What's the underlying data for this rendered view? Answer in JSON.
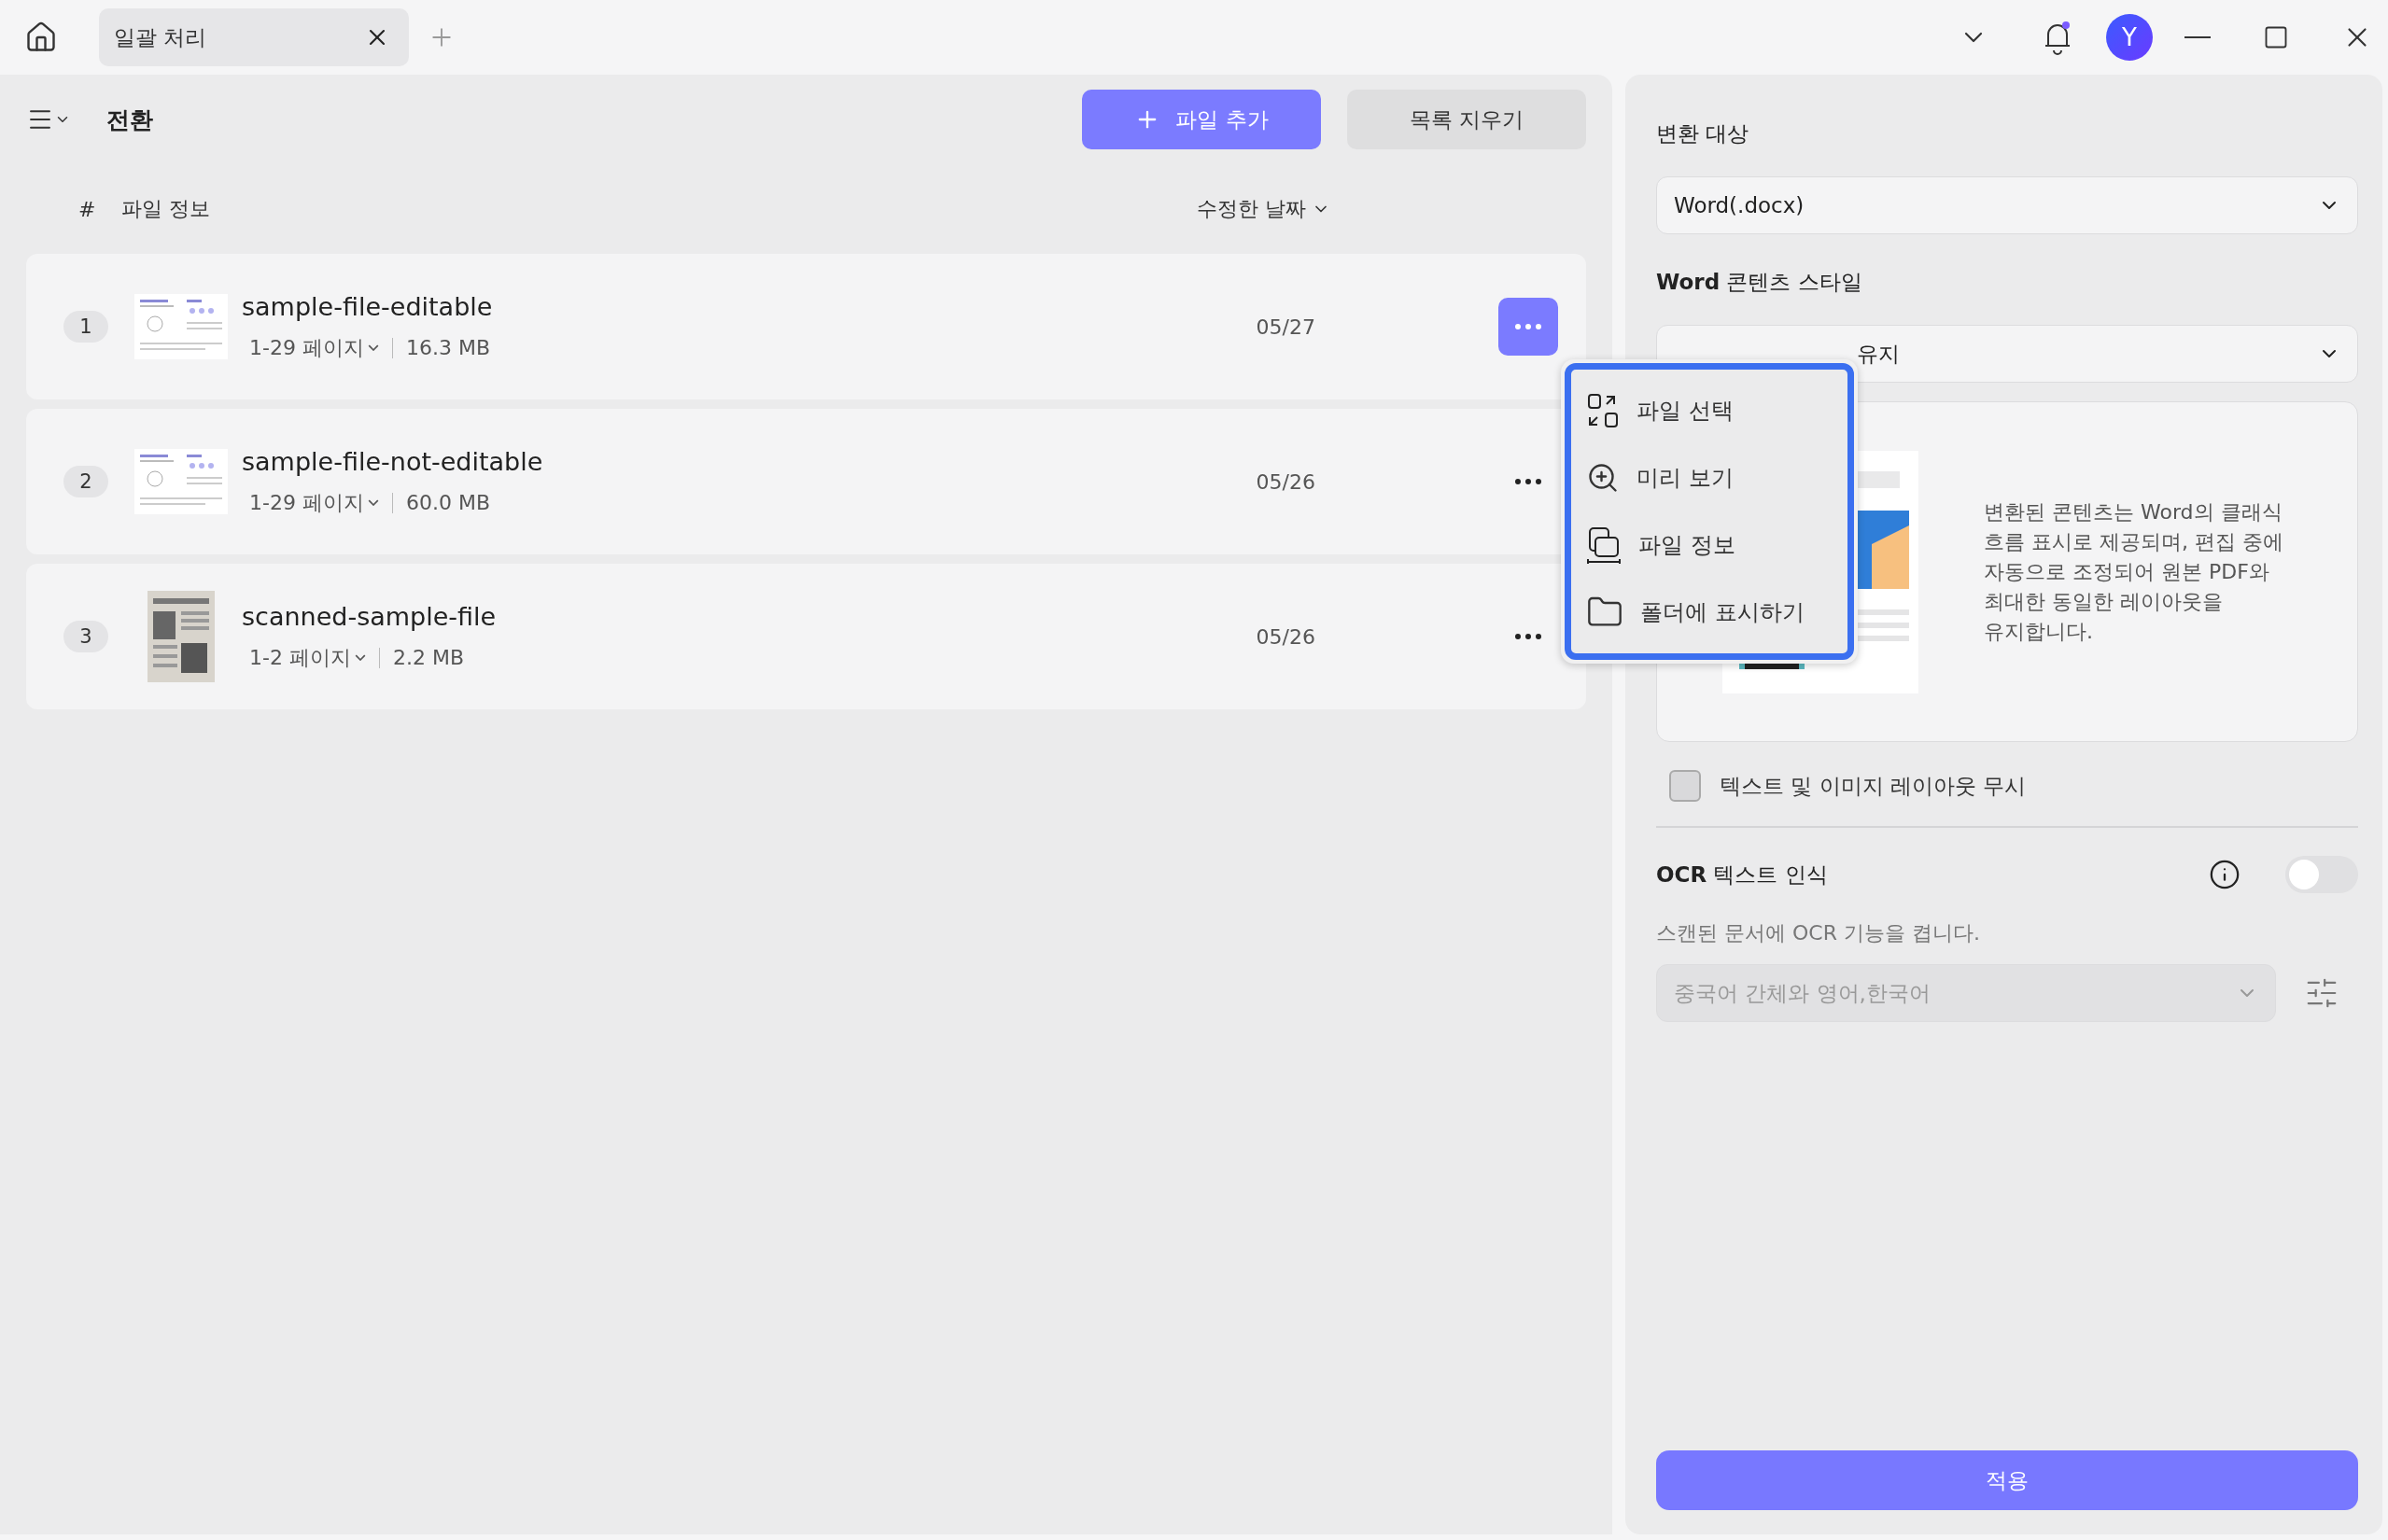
{
  "tab": {
    "title": "일괄 처리"
  },
  "avatar": "Y",
  "toolbar": {
    "title": "전환",
    "add_button": "파일 추가",
    "clear_button": "목록 지우기"
  },
  "columns": {
    "number": "#",
    "info": "파일 정보",
    "date": "수정한 날짜"
  },
  "files": [
    {
      "number": "1",
      "name": "sample-file-editable",
      "pages": "1-29 페이지",
      "size": "16.3 MB",
      "date": "05/27",
      "kind": "document",
      "selected": true
    },
    {
      "number": "2",
      "name": "sample-file-not-editable",
      "pages": "1-29 페이지",
      "size": "60.0 MB",
      "date": "05/26",
      "kind": "document",
      "selected": false
    },
    {
      "number": "3",
      "name": "scanned-sample-file",
      "pages": "1-2 페이지",
      "size": "2.2 MB",
      "date": "05/26",
      "kind": "scanned",
      "selected": false
    }
  ],
  "context_menu": [
    {
      "kind": "select",
      "label": "파일 선택"
    },
    {
      "kind": "preview",
      "label": "미리 보기"
    },
    {
      "kind": "info",
      "label": "파일 정보"
    },
    {
      "kind": "folder",
      "label": "폴더에 표시하기"
    }
  ],
  "settings": {
    "target_label": "변환 대상",
    "target_value": "Word(.docx)",
    "style_label": "**Word** 콘텐츠 스타일",
    "style_value": "유지",
    "style_description": "변환된 콘텐츠는 Word의 클래식 흐름 표시로 제공되며, 편집 중에 자동으로 조정되어 원본 PDF와 최대한 동일한 레이아웃을 유지합니다.",
    "ignore_layout": {
      "label": "텍스트 및 이미지 레이아웃 무시",
      "checked": false
    },
    "ocr": {
      "label": "**OCR** 텍스트 인식",
      "on": false,
      "description": "스캔된 문서에 OCR 기능을 켭니다.",
      "language": "중국어 간체와 영어,한국어",
      "disabled": true
    },
    "apply_button": "적용"
  }
}
